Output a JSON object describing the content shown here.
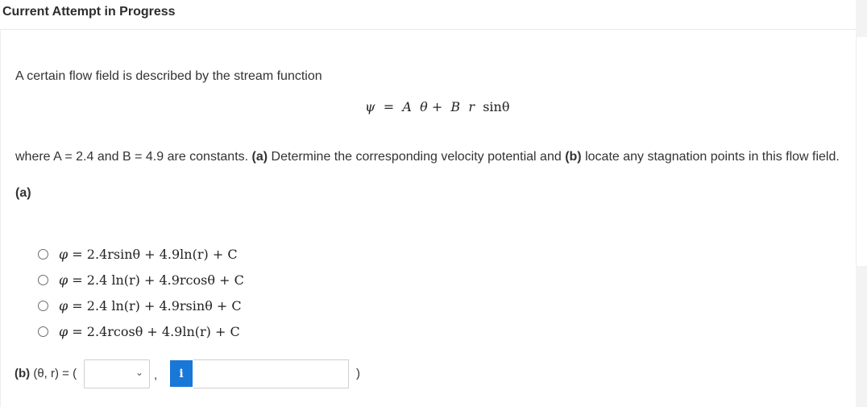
{
  "header": {
    "title": "Current Attempt in Progress"
  },
  "question": {
    "intro": "A certain flow field is described by the stream function",
    "equation": {
      "psi": "ψ",
      "eq": "=",
      "A": "A",
      "theta1": "θ",
      "plus": "+",
      "B": "B",
      "r": "r",
      "sin": "sinθ"
    },
    "desc_pre": "where A = 2.4 and B = 4.9 are constants. ",
    "desc_a": "(a)",
    "desc_mid": " Determine the corresponding velocity potential and ",
    "desc_b": "(b)",
    "desc_post": " locate any stagnation points in this flow field.",
    "part_a_label": "(a)"
  },
  "options": [
    {
      "phi": "φ",
      "eq": "=",
      "text": "2.4rsinθ + 4.9ln(r) + C"
    },
    {
      "phi": "φ",
      "eq": "=",
      "text": "2.4 ln(r) + 4.9rcosθ + C"
    },
    {
      "phi": "φ",
      "eq": "=",
      "text": "2.4 ln(r) + 4.9rsinθ + C"
    },
    {
      "phi": "φ",
      "eq": "=",
      "text": "2.4rcosθ + 4.9ln(r) + C"
    }
  ],
  "part_b": {
    "label_b": "(b)",
    "label_rest": " (θ, r) = (",
    "comma": ",",
    "info_icon_glyph": "i",
    "close_paren": ")",
    "select_value": "",
    "input_value": ""
  },
  "colors": {
    "info_button": "#1878d8",
    "text": "#333333"
  }
}
